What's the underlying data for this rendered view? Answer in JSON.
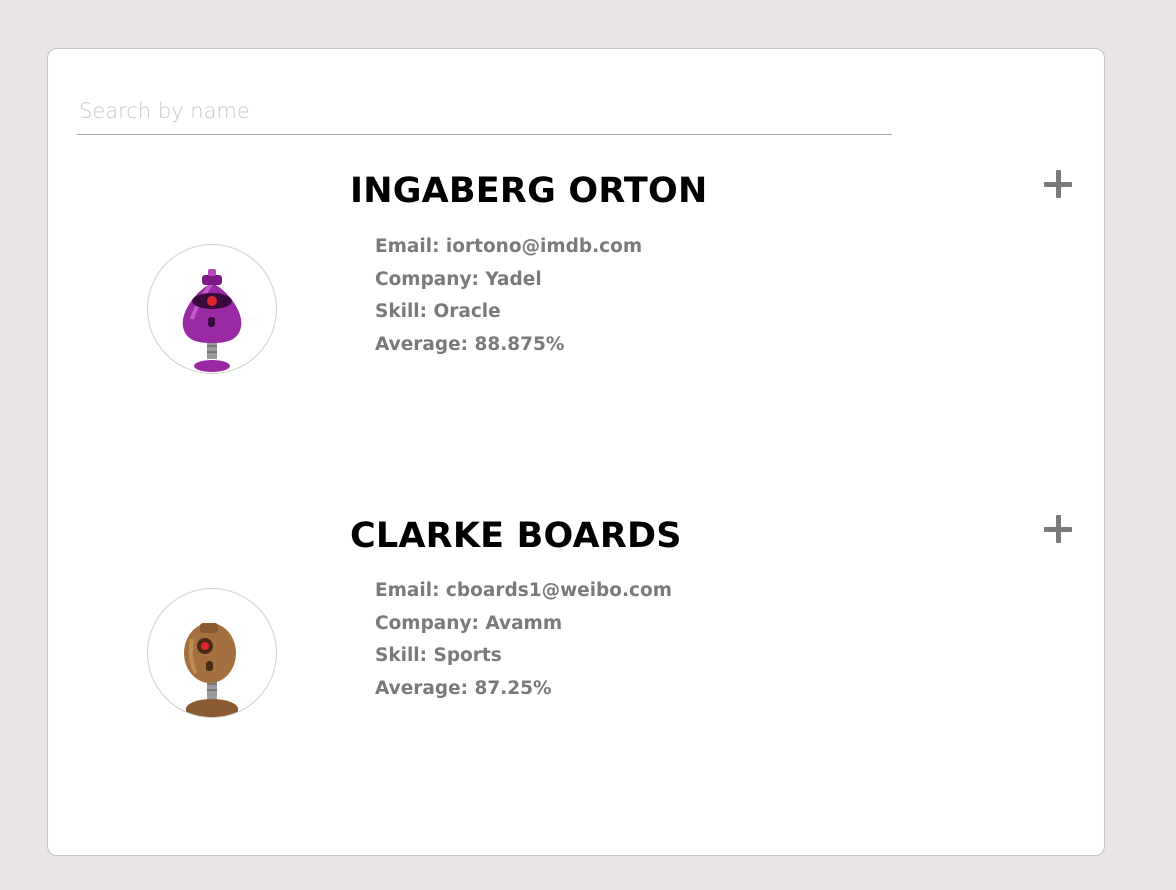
{
  "search": {
    "placeholder": "Search by name",
    "value": ""
  },
  "students": [
    {
      "name": "INGABERG ORTON",
      "email_label": "Email: iortono@imdb.com",
      "company_label": "Company: Yadel",
      "skill_label": "Skill: Oracle",
      "average_label": "Average: 88.875%",
      "avatar_color": "#8e1f9a",
      "expand_icon": "plus-icon"
    },
    {
      "name": "CLARKE BOARDS",
      "email_label": "Email: cboards1@weibo.com",
      "company_label": "Company: Avamm",
      "skill_label": "Skill: Sports",
      "average_label": "Average: 87.25%",
      "avatar_color": "#9a6a3c",
      "expand_icon": "plus-icon"
    }
  ],
  "colors": {
    "page_background": "#e9e5e4",
    "card_background": "#ffffff",
    "name_text": "#000000",
    "detail_text": "#7a7a7a",
    "placeholder_text": "#c6c6c6"
  }
}
